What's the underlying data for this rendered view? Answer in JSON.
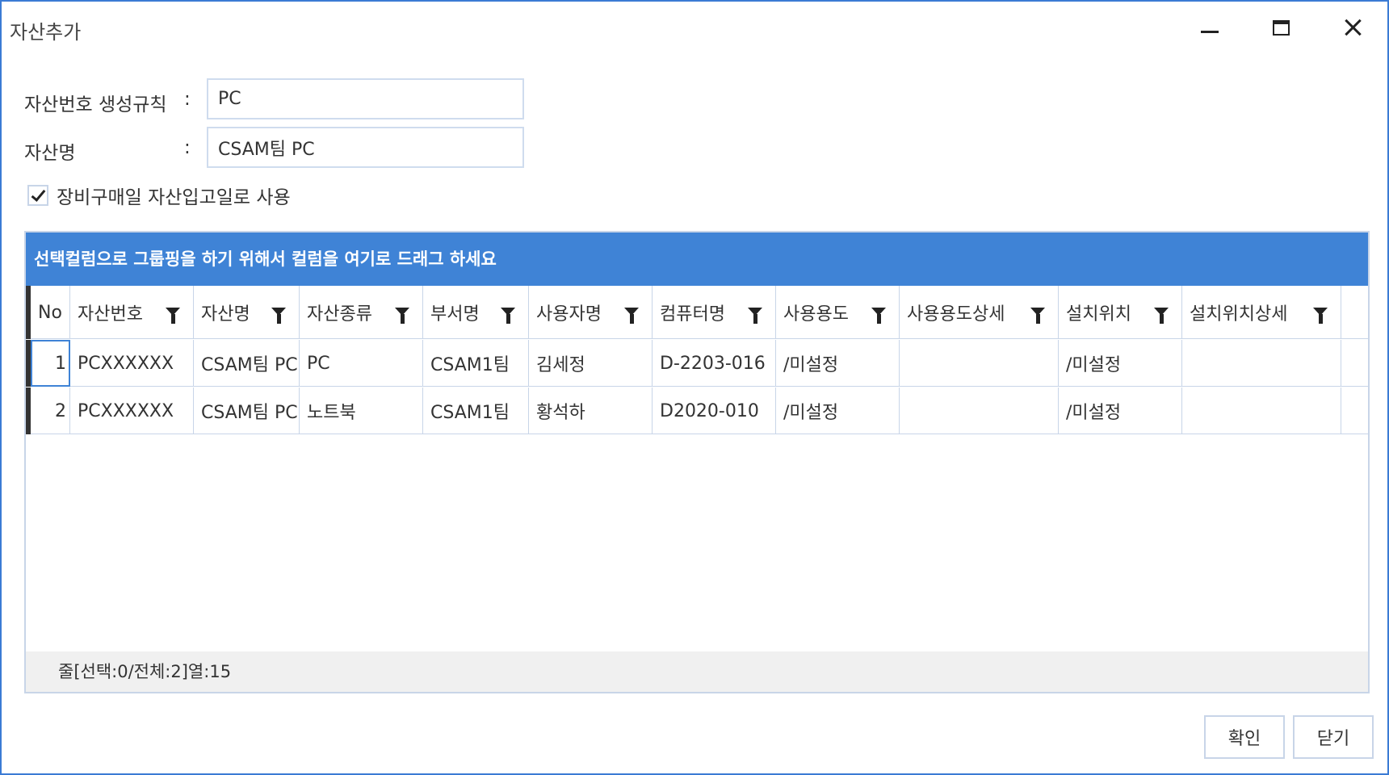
{
  "window": {
    "title": "자산추가"
  },
  "form": {
    "rule_label": "자산번호 생성규칙",
    "rule_colon": ":",
    "rule_value": "PC",
    "name_label": "자산명",
    "name_colon": ":",
    "name_value": "CSAM팀 PC",
    "checkbox_label": "장비구매일 자산입고일로 사용",
    "checkbox_checked": true
  },
  "grid": {
    "group_panel_text": "선택컬럼으로 그룹핑을 하기 위해서 컬럼을 여기로 드래그 하세요",
    "columns": [
      "No",
      "자산번호",
      "자산명",
      "자산종류",
      "부서명",
      "사용자명",
      "컴퓨터명",
      "사용용도",
      "사용용도상세",
      "설치위치",
      "설치위치상세"
    ],
    "rows": [
      [
        "1",
        "PCXXXXXX",
        "CSAM팀 PC",
        "PC",
        "CSAM1팀",
        "김세정",
        "D-2203-016",
        "/미설정",
        "",
        "/미설정",
        ""
      ],
      [
        "2",
        "PCXXXXXX",
        "CSAM팀 PC",
        "노트북",
        "CSAM1팀",
        "황석하",
        "D2020-010",
        "/미설정",
        "",
        "/미설정",
        ""
      ]
    ],
    "status_text": "줄[선택:0/전체:2]열:15"
  },
  "buttons": {
    "ok_label": "확인",
    "close_label": "닫기"
  },
  "colors": {
    "accent": "#3f83d6",
    "border": "#c8d5e8",
    "window_border": "#3b7bd4"
  }
}
